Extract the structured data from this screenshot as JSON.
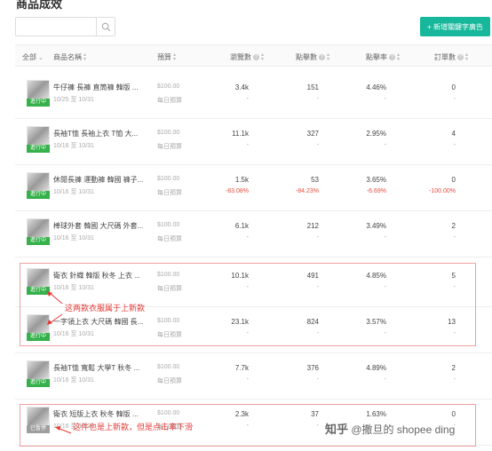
{
  "page": {
    "title": "商品成效"
  },
  "search": {
    "placeholder": ""
  },
  "add_button": {
    "label": "+ 新增關鍵字廣告"
  },
  "columns": {
    "all": "全部",
    "name": "商品名稱",
    "budget": "預算",
    "views": "瀏覽數",
    "clicks": "點擊數",
    "ctr": "點擊率",
    "orders": "訂單數"
  },
  "rows": [
    {
      "name": "牛仔褲 長褲 直筒褲 韓版 ...",
      "date": "10/25 至 10/31",
      "status": "進行中",
      "budget": "$100.00",
      "budget_sub": "每日預算",
      "views": "3.4k",
      "views_sub": "-",
      "clicks": "151",
      "clicks_sub": "-",
      "ctr": "4.46%",
      "ctr_sub": "-",
      "orders": "0",
      "orders_sub": "-"
    },
    {
      "name": "長袖T恤 長袖上衣 T恤 大...",
      "date": "10/16 至 10/31",
      "status": "進行中",
      "budget": "$100.00",
      "budget_sub": "每日預算",
      "views": "11.1k",
      "views_sub": "-",
      "clicks": "327",
      "clicks_sub": "-",
      "ctr": "2.95%",
      "ctr_sub": "-",
      "orders": "4",
      "orders_sub": "-"
    },
    {
      "name": "休閒長褲 運動褲 韓國 褲子...",
      "date": "10/16 至 10/31",
      "status": "進行中",
      "budget": "$100.00",
      "budget_sub": "每日預算",
      "views": "1.5k",
      "views_sub": "-83.08%",
      "clicks": "53",
      "clicks_sub": "-84.23%",
      "ctr": "3.65%",
      "ctr_sub": "-6.69%",
      "orders": "0",
      "orders_sub": "-100.00%"
    },
    {
      "name": "棒球外套 韓國 大尺碼 外套...",
      "date": "10/16 至 10/31",
      "status": "進行中",
      "budget": "$100.00",
      "budget_sub": "每日預算",
      "views": "6.1k",
      "views_sub": "-",
      "clicks": "212",
      "clicks_sub": "-",
      "ctr": "3.49%",
      "ctr_sub": "-",
      "orders": "2",
      "orders_sub": "-"
    },
    {
      "name": "衛衣 針織 韓版 秋冬 上衣 ...",
      "date": "10/16 至 10/31",
      "status": "進行中",
      "budget": "$100.00",
      "budget_sub": "每日預算",
      "views": "10.1k",
      "views_sub": "-",
      "clicks": "491",
      "clicks_sub": "-",
      "ctr": "4.85%",
      "ctr_sub": "-",
      "orders": "5",
      "orders_sub": "-"
    },
    {
      "name": "一字領上衣 大尺碼 韓國 長...",
      "date": "10/16 至 10/31",
      "status": "進行中",
      "budget": "$100.00",
      "budget_sub": "每日預算",
      "views": "23.1k",
      "views_sub": "-",
      "clicks": "824",
      "clicks_sub": "-",
      "ctr": "3.57%",
      "ctr_sub": "-",
      "orders": "13",
      "orders_sub": "-"
    },
    {
      "name": "長袖T恤 寬鬆 大學T 秋冬 ...",
      "date": "10/16 至 10/31",
      "status": "進行中",
      "budget": "$100.00",
      "budget_sub": "每日預算",
      "views": "7.7k",
      "views_sub": "-",
      "clicks": "376",
      "clicks_sub": "-",
      "ctr": "4.89%",
      "ctr_sub": "-",
      "orders": "2",
      "orders_sub": "-"
    },
    {
      "name": "衛衣 短版上衣 秋冬 韓版 ...",
      "date": "10/16 至 10/20",
      "status": "已暫停",
      "budget": "$100.00",
      "budget_sub": "每日預算",
      "views": "2.3k",
      "views_sub": "-",
      "clicks": "37",
      "clicks_sub": "-",
      "ctr": "1.63%",
      "ctr_sub": "-",
      "orders": "0",
      "orders_sub": "-"
    }
  ],
  "annotations": {
    "new_items": "这两款衣服属于上新款",
    "low_ctr": "这件也是上新款，但是点击率下滑"
  },
  "watermark": {
    "logo": "知乎",
    "author": "@撒旦的 shopee ding"
  }
}
